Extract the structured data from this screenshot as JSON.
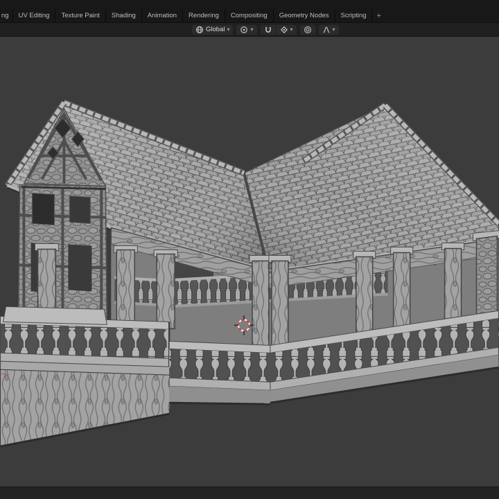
{
  "topbar": {
    "tabs": [
      {
        "label": "ng"
      },
      {
        "label": "UV Editing"
      },
      {
        "label": "Texture Paint"
      },
      {
        "label": "Shading"
      },
      {
        "label": "Animation"
      },
      {
        "label": "Rendering"
      },
      {
        "label": "Compositing"
      },
      {
        "label": "Geometry Nodes"
      },
      {
        "label": "Scripting"
      },
      {
        "label": "+"
      }
    ]
  },
  "tool_header": {
    "orientation_label": "Global",
    "chevron": "▾"
  },
  "colors": {
    "topbar_bg": "#181818",
    "header_bg": "#202020",
    "widget_bg": "#2b2b2b",
    "viewport_bg": "#3c3c3c",
    "statusbar_bg": "#232323",
    "text": "#c8c8c8",
    "model_light": "#b5b5b5",
    "model_mid": "#9a9a9a",
    "model_shadow": "#4a4a4a",
    "cursor_red": "#d43c3c"
  }
}
